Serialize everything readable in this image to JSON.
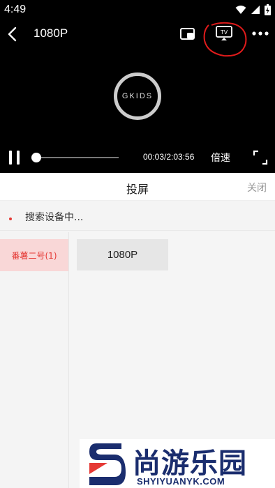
{
  "status_bar": {
    "time": "4:49",
    "icons": [
      "wifi-icon",
      "signal-icon",
      "battery-icon"
    ]
  },
  "player": {
    "title": "1080P",
    "logo_text": "GKIDS",
    "time_readout": "00:03/2:03:56",
    "speed_label": "倍速",
    "progress_fraction": 0.0004,
    "icons": [
      "back-icon",
      "pip-icon",
      "cast-tv-icon",
      "more-icon",
      "pause-icon",
      "fullscreen-icon"
    ],
    "cast_icon_label": "TV"
  },
  "panel": {
    "title": "投屏",
    "close_label": "关闭",
    "search_text": "搜索设备中...",
    "devices": [
      {
        "label": "番薯二号(1)",
        "selected": true
      }
    ],
    "quality_options": [
      "1080P"
    ]
  },
  "watermark": {
    "brand_cn": "尚游乐园",
    "brand_en": "SHYIYUANYK.COM"
  },
  "colors": {
    "accent": "#e53935",
    "selected_bg": "#f9d7d7",
    "annotation": "#e01b1b",
    "brand": "#1a2d6e"
  }
}
